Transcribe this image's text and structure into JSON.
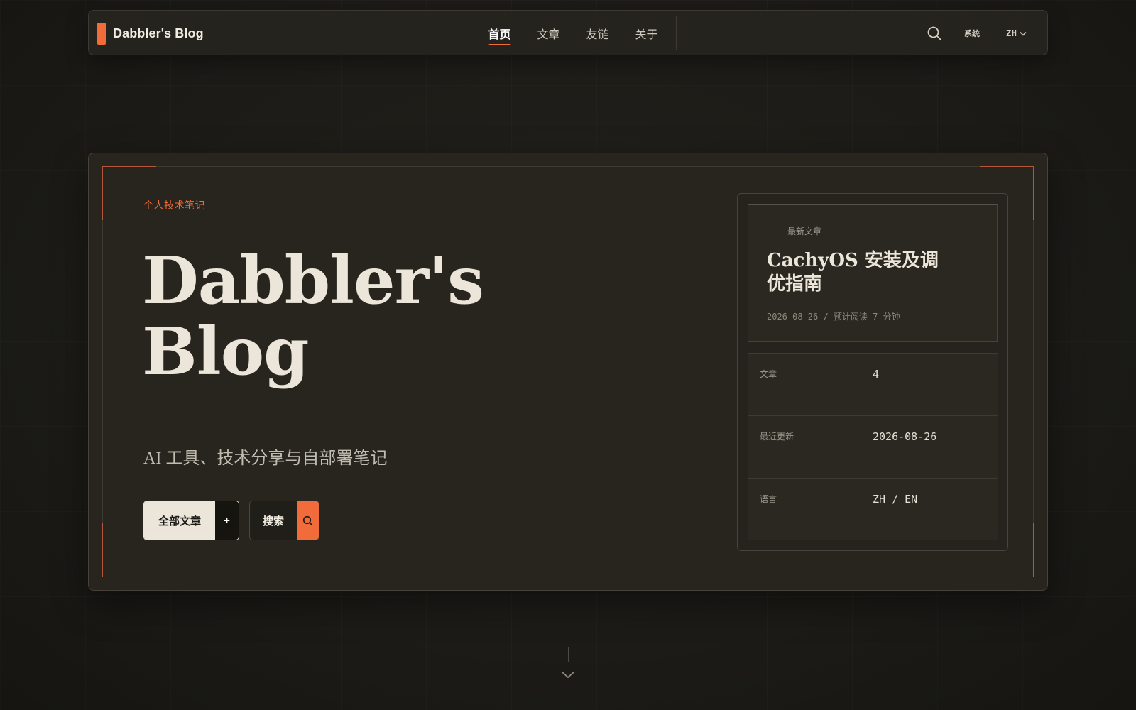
{
  "brand": {
    "name": "Dabbler's Blog",
    "accent": "#f26b3a"
  },
  "nav": {
    "items": [
      {
        "label": "首页",
        "active": true
      },
      {
        "label": "文章",
        "active": false
      },
      {
        "label": "友链",
        "active": false
      },
      {
        "label": "关于",
        "active": false
      }
    ],
    "theme_label": "系统",
    "lang_label": "ZH"
  },
  "hero": {
    "kicker": "个人技术笔记",
    "title_line1": "Dabbler's",
    "title_line2": "Blog",
    "subtitle": "AI 工具、技术分享与自部署笔记",
    "primary_button": "全部文章",
    "primary_button_icon": "+",
    "search_button": "搜索"
  },
  "latest": {
    "label": "最新文章",
    "title": "CachyOS 安装及调优指南",
    "meta": "2026-08-26 / 预计阅读 7 分钟"
  },
  "stats": [
    {
      "label": "文章",
      "value": "4"
    },
    {
      "label": "最近更新",
      "value": "2026-08-26"
    },
    {
      "label": "语言",
      "value": "ZH / EN"
    }
  ],
  "icons": {
    "search": "search-icon",
    "chevron": "chevron-down-icon"
  }
}
